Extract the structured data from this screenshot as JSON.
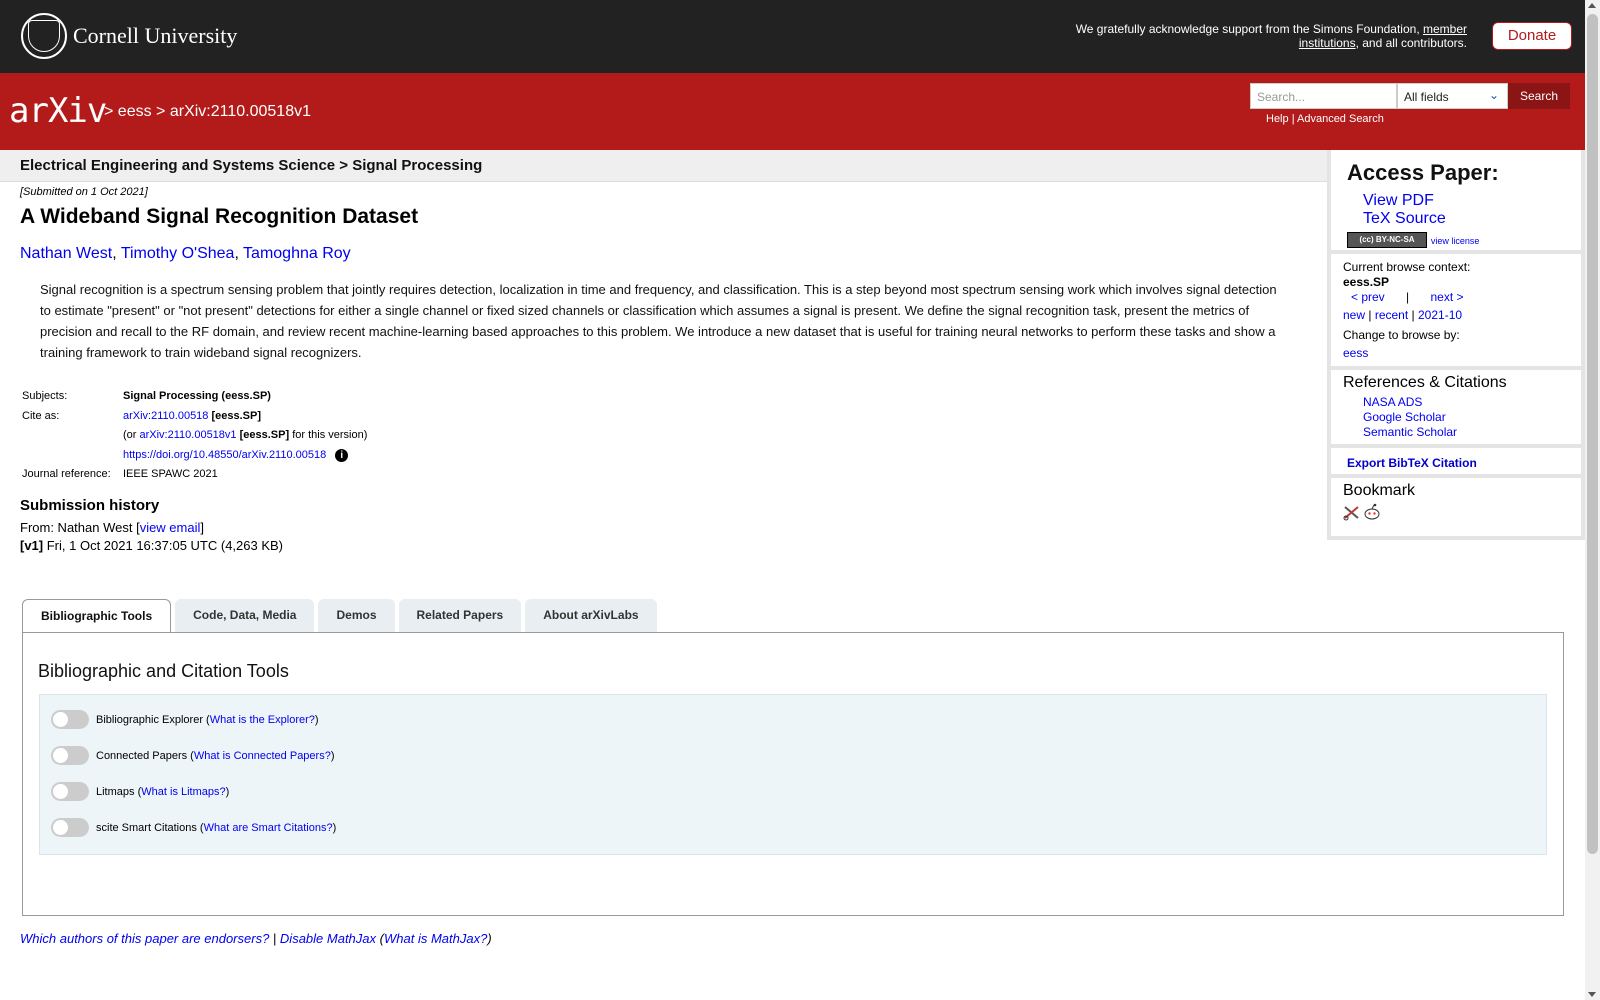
{
  "cornell": {
    "name": "Cornell University",
    "support_prefix": "We gratefully acknowledge support from the Simons Foundation, ",
    "support_link": "member institutions",
    "support_suffix": ", and all contributors.",
    "donate": "Donate"
  },
  "arxiv": {
    "logo": "arXiv",
    "crumb_sep": ">",
    "crumb_category": "eess",
    "crumb_id": "arXiv:2110.00518v1",
    "search_placeholder": "Search...",
    "search_field": "All fields",
    "search_button": "Search",
    "help": "Help",
    "advanced": "Advanced Search",
    "links_sep": "|"
  },
  "subheader": "Electrical Engineering and Systems Science > Signal Processing",
  "paper": {
    "submitted": "[Submitted on 1 Oct 2021]",
    "title": "A Wideband Signal Recognition Dataset",
    "authors": [
      "Nathan West",
      "Timothy O'Shea",
      "Tamoghna Roy"
    ],
    "author_sep": ", ",
    "abstract": "Signal recognition is a spectrum sensing problem that jointly requires detection, localization in time and frequency, and classification. This is a step beyond most spectrum sensing work which involves signal detection to estimate \"present\" or \"not present\" detections for either a single channel or fixed sized channels or classification which assumes a signal is present. We define the signal recognition task, present the metrics of precision and recall to the RF domain, and review recent machine-learning based approaches to this problem. We introduce a new dataset that is useful for training neural networks to perform these tasks and show a training framework to train wideband signal recognizers."
  },
  "meta": {
    "subjects_label": "Subjects:",
    "subjects_value": "Signal Processing (eess.SP)",
    "cite_label": "Cite as:",
    "cite_id": "arXiv:2110.00518",
    "cite_tag": "[eess.SP]",
    "version_prefix": "(or ",
    "version_id": "arXiv:2110.00518v1",
    "version_tag": "[eess.SP]",
    "version_suffix": " for this version)",
    "doi": "https://doi.org/10.48550/arXiv.2110.00518",
    "info_glyph": "i",
    "journal_label": "Journal reference:",
    "journal_value": "IEEE SPAWC 2021"
  },
  "history": {
    "heading": "Submission history",
    "from_prefix": "From: Nathan West [",
    "view_email": "view email",
    "from_suffix": "]",
    "version_label": "[v1]",
    "version_detail": " Fri, 1 Oct 2021 16:37:05 UTC (4,263 KB)"
  },
  "tabs": [
    "Bibliographic Tools",
    "Code, Data, Media",
    "Demos",
    "Related Papers",
    "About arXivLabs"
  ],
  "panel": {
    "title": "Bibliographic and Citation Tools",
    "tools": [
      {
        "label": "Bibliographic Explorer",
        "link": "What is the Explorer?"
      },
      {
        "label": "Connected Papers",
        "link": "What is Connected Papers?"
      },
      {
        "label": "Litmaps",
        "link": "What is Litmaps?"
      },
      {
        "label": "scite Smart Citations",
        "link": "What are Smart Citations?"
      }
    ]
  },
  "footer": {
    "endorsers": "Which authors of this paper are endorsers?",
    "sep": " | ",
    "mathjax": "Disable MathJax",
    "what_mathjax": "What is MathJax?"
  },
  "sidebar": {
    "access_heading": "Access Paper:",
    "view_pdf": "View PDF",
    "tex_source": "TeX Source",
    "license_badge": "(cc) BY-NC-SA",
    "view_license": "view license",
    "context_label": "Current browse context:",
    "context_value": "eess.SP",
    "prev": "< prev",
    "nav_sep": "|",
    "next": "next >",
    "new": "new",
    "recent": "recent",
    "month": "2021-10",
    "change_label": "Change to browse by:",
    "change_value": "eess",
    "refs_heading": "References & Citations",
    "refs": [
      "NASA ADS",
      "Google Scholar",
      "Semantic Scholar"
    ],
    "export": "Export BibTeX Citation",
    "bookmark_heading": "Bookmark"
  }
}
